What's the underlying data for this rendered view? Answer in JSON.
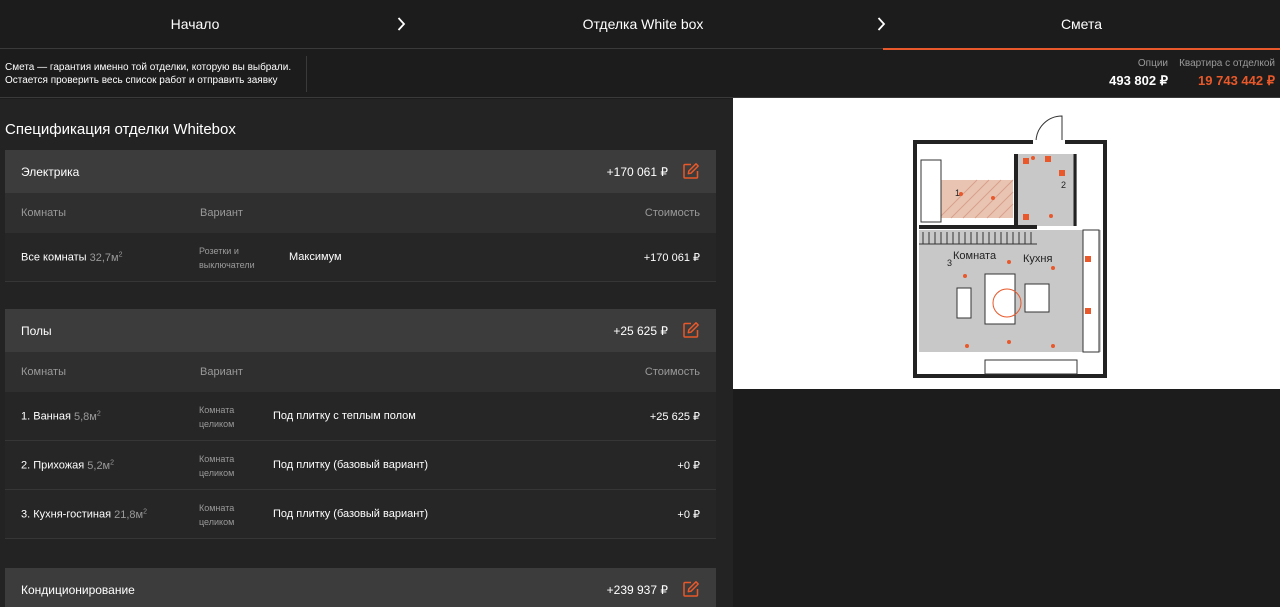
{
  "steps": [
    {
      "label": "Начало"
    },
    {
      "label": "Отделка White box"
    },
    {
      "label": "Смета"
    }
  ],
  "info": {
    "line1": "Смета — гарантия именно той отделки, которую вы выбрали.",
    "line2": "Остается проверить весь список работ и отправить заявку",
    "options_label": "Опции",
    "options_value": "493 802 ₽",
    "total_label": "Квартира с отделкой",
    "total_value": "19 743 442 ₽"
  },
  "spec": {
    "title": "Спецификация отделки Whitebox",
    "columns": {
      "rooms": "Комнаты",
      "variant": "Вариант",
      "cost": "Стоимость"
    },
    "groups": [
      {
        "name": "Электрика",
        "sum": "+170 061 ₽",
        "rows": [
          {
            "room": "Все комнаты",
            "area": "32,7м",
            "sup": "2",
            "variant_type": "Розетки и выключатели",
            "option": "Максимум",
            "cost": "+170 061 ₽"
          }
        ]
      },
      {
        "name": "Полы",
        "sum": "+25 625 ₽",
        "rows": [
          {
            "room": "1. Ванная",
            "area": "5,8м",
            "sup": "2",
            "variant_type": "Комната целиком",
            "option": "Под плитку с теплым полом",
            "cost": "+25 625 ₽"
          },
          {
            "room": "2. Прихожая",
            "area": "5,2м",
            "sup": "2",
            "variant_type": "Комната целиком",
            "option": "Под плитку (базовый вариант)",
            "cost": "+0 ₽"
          },
          {
            "room": "3. Кухня-гостиная",
            "area": "21,8м",
            "sup": "2",
            "variant_type": "Комната целиком",
            "option": "Под плитку (базовый вариант)",
            "cost": "+0 ₽"
          }
        ]
      },
      {
        "name": "Кондиционирование",
        "sum": "+239 937 ₽",
        "rows": []
      }
    ]
  },
  "plan": {
    "labels": {
      "bath": "1",
      "hall": "2",
      "room_no": "3",
      "room": "Комната",
      "kitchen": "Кухня"
    }
  },
  "colors": {
    "accent": "#e8582a",
    "bg": "#1c1c1c",
    "panel": "#232323",
    "header": "#3c3c3c"
  },
  "icons": {
    "edit": "edit-icon",
    "chevron": "chevron-right-icon"
  }
}
